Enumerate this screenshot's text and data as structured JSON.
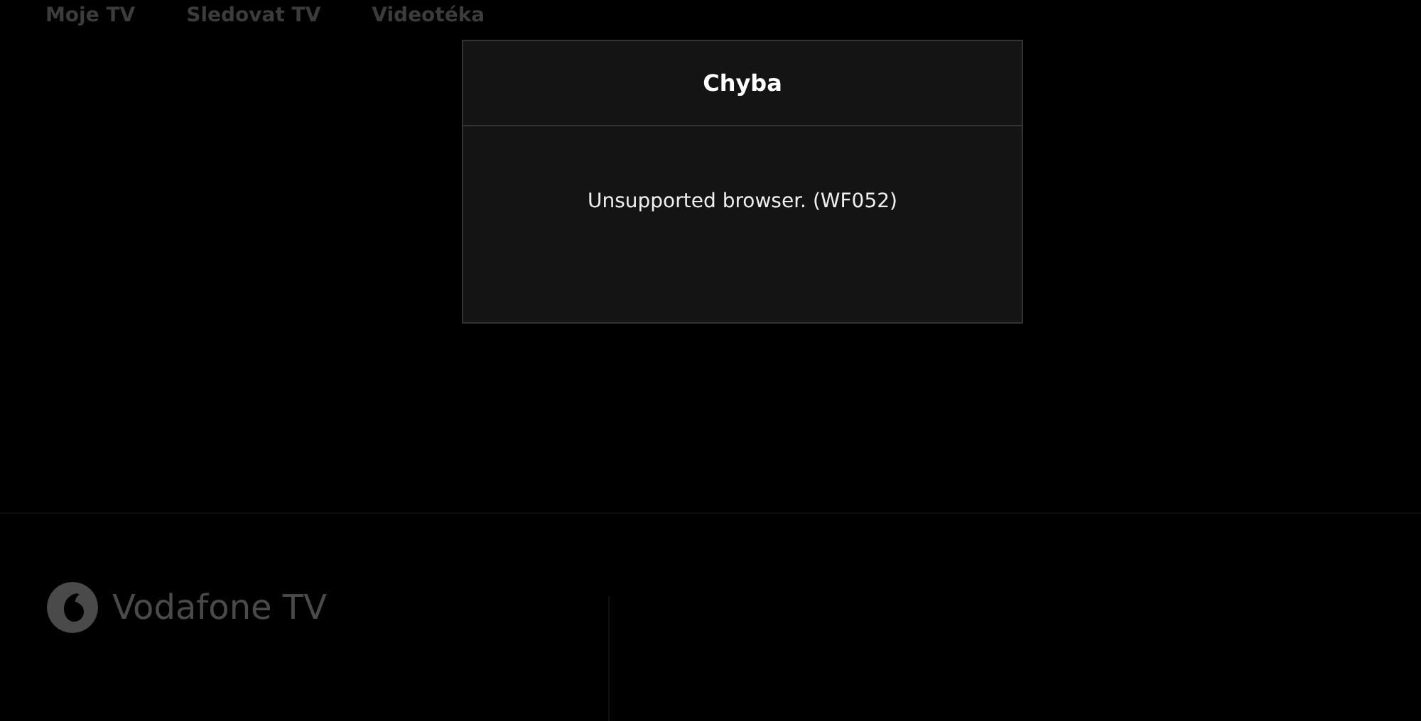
{
  "nav": {
    "items": [
      {
        "label": "Moje TV"
      },
      {
        "label": "Sledovat TV"
      },
      {
        "label": "Videotéka"
      }
    ]
  },
  "dialog": {
    "title": "Chyba",
    "message": "Unsupported browser. (WF052)"
  },
  "footer": {
    "brand": "Vodafone TV"
  }
}
